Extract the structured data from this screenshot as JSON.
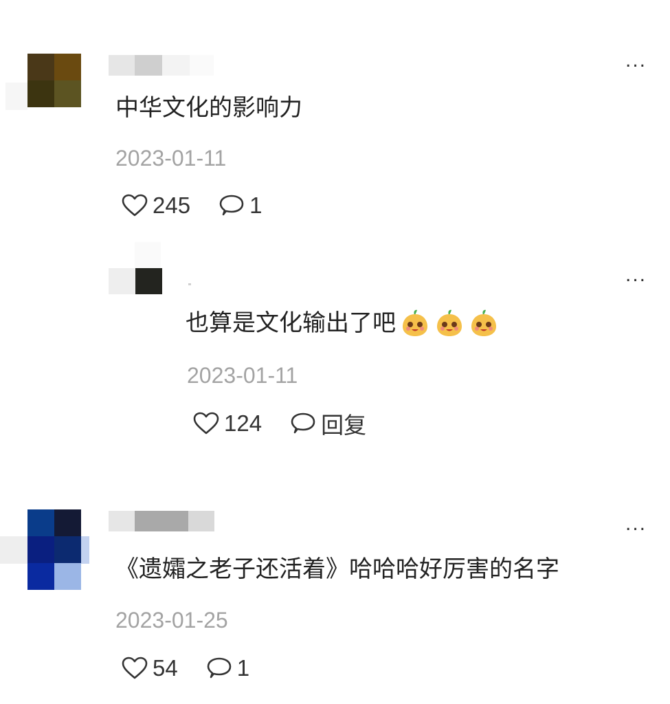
{
  "comments": [
    {
      "text": "中华文化的影响力",
      "date": "2023-01-11",
      "likes": "245",
      "reply_count": "1"
    },
    {
      "text": "也算是文化输出了吧",
      "date": "2023-01-11",
      "likes": "124",
      "reply_label": "回复",
      "emoji_count": 3,
      "emoji_name": "happy-face-emoji"
    },
    {
      "text": "《遗孀之老子还活着》哈哈哈好厉害的名字",
      "date": "2023-01-25",
      "likes": "54",
      "reply_count": "1"
    }
  ],
  "more_label": "...",
  "icons": {
    "like": "heart-outline-icon",
    "comment": "speech-bubble-icon",
    "more": "more-dots-icon"
  },
  "colors": {
    "text": "#222222",
    "date": "#a3a3a3",
    "icon": "#333333"
  }
}
